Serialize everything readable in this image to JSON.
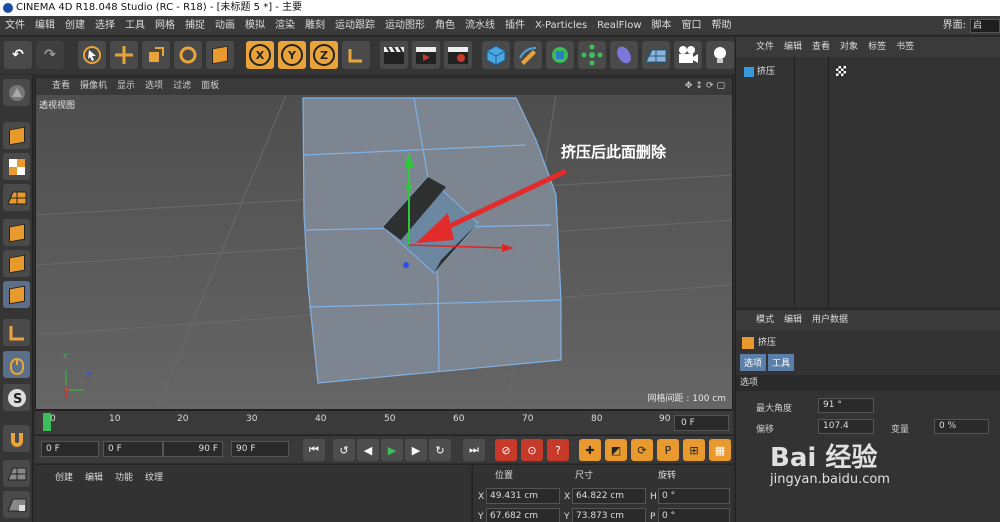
{
  "window": {
    "title": "CINEMA 4D R18.048 Studio (RC - R18) - [未标题 5 *] - 主要"
  },
  "menu": [
    "文件",
    "编辑",
    "创建",
    "选择",
    "工具",
    "网格",
    "捕捉",
    "动画",
    "模拟",
    "渲染",
    "雕刻",
    "运动跟踪",
    "运动图形",
    "角色",
    "流水线",
    "插件",
    "X-Particles",
    "RealFlow",
    "脚本",
    "窗口",
    "帮助"
  ],
  "layout": {
    "label": "界面:",
    "value": "启"
  },
  "viewport": {
    "menu": [
      "查看",
      "摄像机",
      "显示",
      "选项",
      "过滤",
      "面板"
    ],
    "label": "透视视图",
    "grid_readout": "网格间距 : 100 cm",
    "annotation": "挤压后此面删除",
    "axis_labels": {
      "x": "X",
      "y": "Y",
      "z": "Z"
    }
  },
  "timeline": {
    "ticks": [
      "0",
      "10",
      "20",
      "30",
      "40",
      "50",
      "60",
      "70",
      "80",
      "90"
    ],
    "current_frame": "0 F"
  },
  "playback": {
    "start": "0 F",
    "range_start": "0 F",
    "range_end": "90 F",
    "end": "90 F"
  },
  "material_manager": {
    "menu": [
      "创建",
      "编辑",
      "功能",
      "纹理"
    ]
  },
  "coordinates": {
    "headers": {
      "position": "位置",
      "size": "尺寸",
      "rotation": "旋转"
    },
    "x": {
      "label": "X",
      "position": "49.431 cm",
      "size": "64.822 cm",
      "rot_label": "H",
      "rotation": "0 °"
    },
    "y": {
      "label": "Y",
      "position": "67.682 cm",
      "size": "73.873 cm",
      "rot_label": "P",
      "rotation": "0 °"
    }
  },
  "object_manager": {
    "menu": [
      "文件",
      "编辑",
      "查看",
      "对象",
      "标签",
      "书签"
    ],
    "objects": [
      {
        "name": "挤压"
      }
    ]
  },
  "attribute_manager": {
    "menu": [
      "模式",
      "编辑",
      "用户数据"
    ],
    "title": "挤压",
    "tabs": [
      "选项",
      "工具"
    ],
    "section": "选项",
    "fields": [
      {
        "label": "最大角度",
        "value": "91 °"
      },
      {
        "label": "偏移",
        "value": "107.4",
        "extra_label": "变量",
        "extra_value": "0 %"
      }
    ]
  },
  "watermark": {
    "brand": "Bai 经验",
    "url": "jingyan.baidu.com"
  },
  "colors": {
    "accent": "#e89a2e",
    "selection": "#5a7fa8",
    "arrow": "#e32b2b"
  }
}
